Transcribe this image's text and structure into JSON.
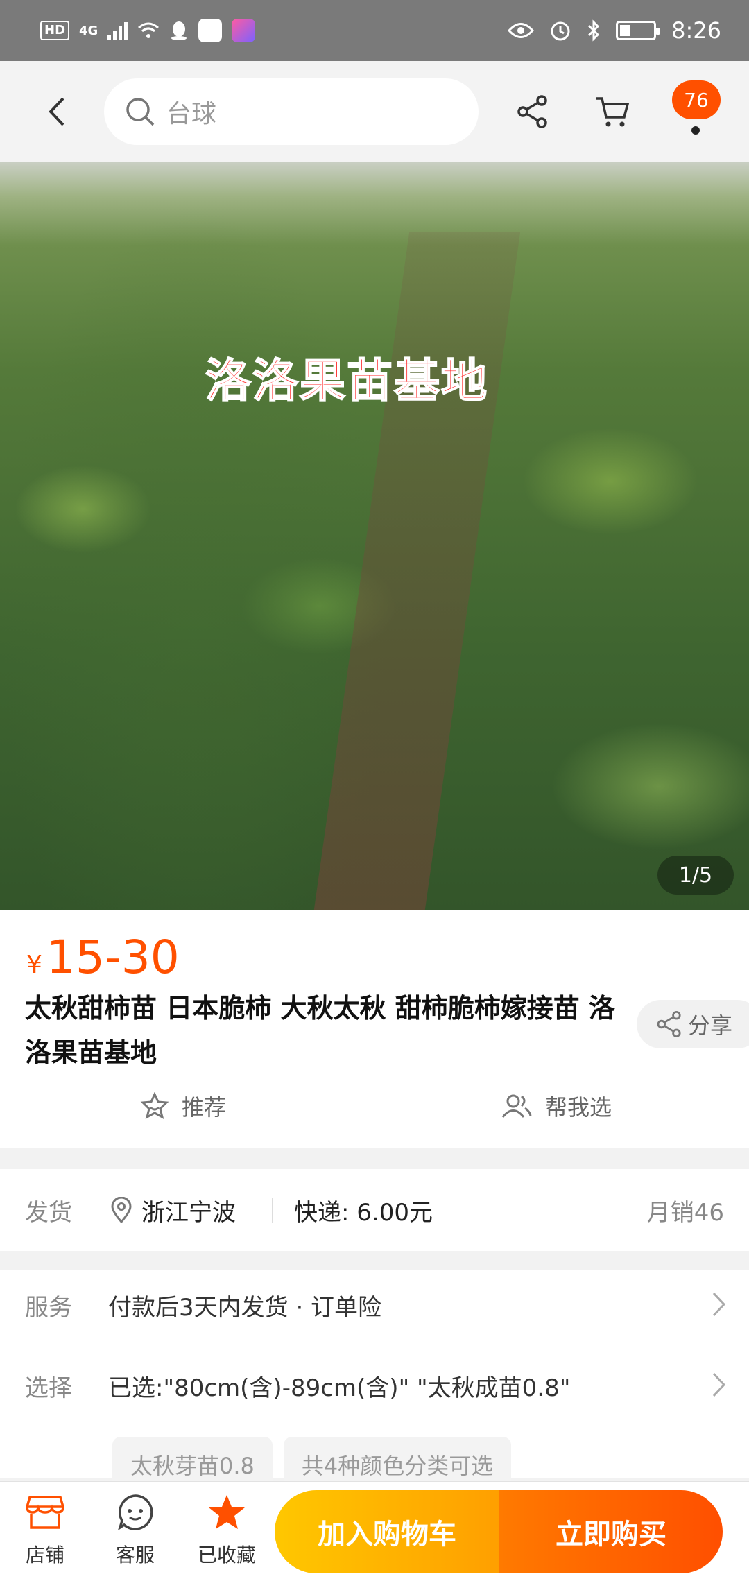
{
  "status_bar": {
    "network_badge": "HD",
    "network_type": "4G",
    "time": "8:26",
    "battery_level": 0.3
  },
  "top_nav": {
    "search_placeholder": "台球",
    "message_count": "76"
  },
  "hero": {
    "caption": "洛洛果苗基地",
    "counter": "1/5"
  },
  "product": {
    "price_symbol": "¥",
    "price": "15-30",
    "title": "太秋甜柿苗 日本脆柿 大秋太秋 甜柿脆柿嫁接苗 洛洛果苗基地",
    "share_label": "分享",
    "recommend_label": "推荐",
    "help_choose_label": "帮我选"
  },
  "shipping": {
    "label": "发货",
    "location": "浙江宁波",
    "fee": "快递: 6.00元",
    "monthly_sales": "月销46"
  },
  "service": {
    "label": "服务",
    "value": "付款后3天内发货 · 订单险"
  },
  "selection": {
    "label": "选择",
    "value": "已选:\"80cm(含)-89cm(含)\" \"太秋成苗0.8\"",
    "chips": [
      "太秋芽苗0.8",
      "共4种颜色分类可选"
    ]
  },
  "bottom_bar": {
    "shop_label": "店铺",
    "service_label": "客服",
    "favorite_label": "已收藏",
    "add_to_cart": "加入购物车",
    "buy_now": "立即购买"
  },
  "colors": {
    "accent": "#ff5000",
    "cart_button": "#ffb300",
    "buy_button": "#ff5a00"
  }
}
